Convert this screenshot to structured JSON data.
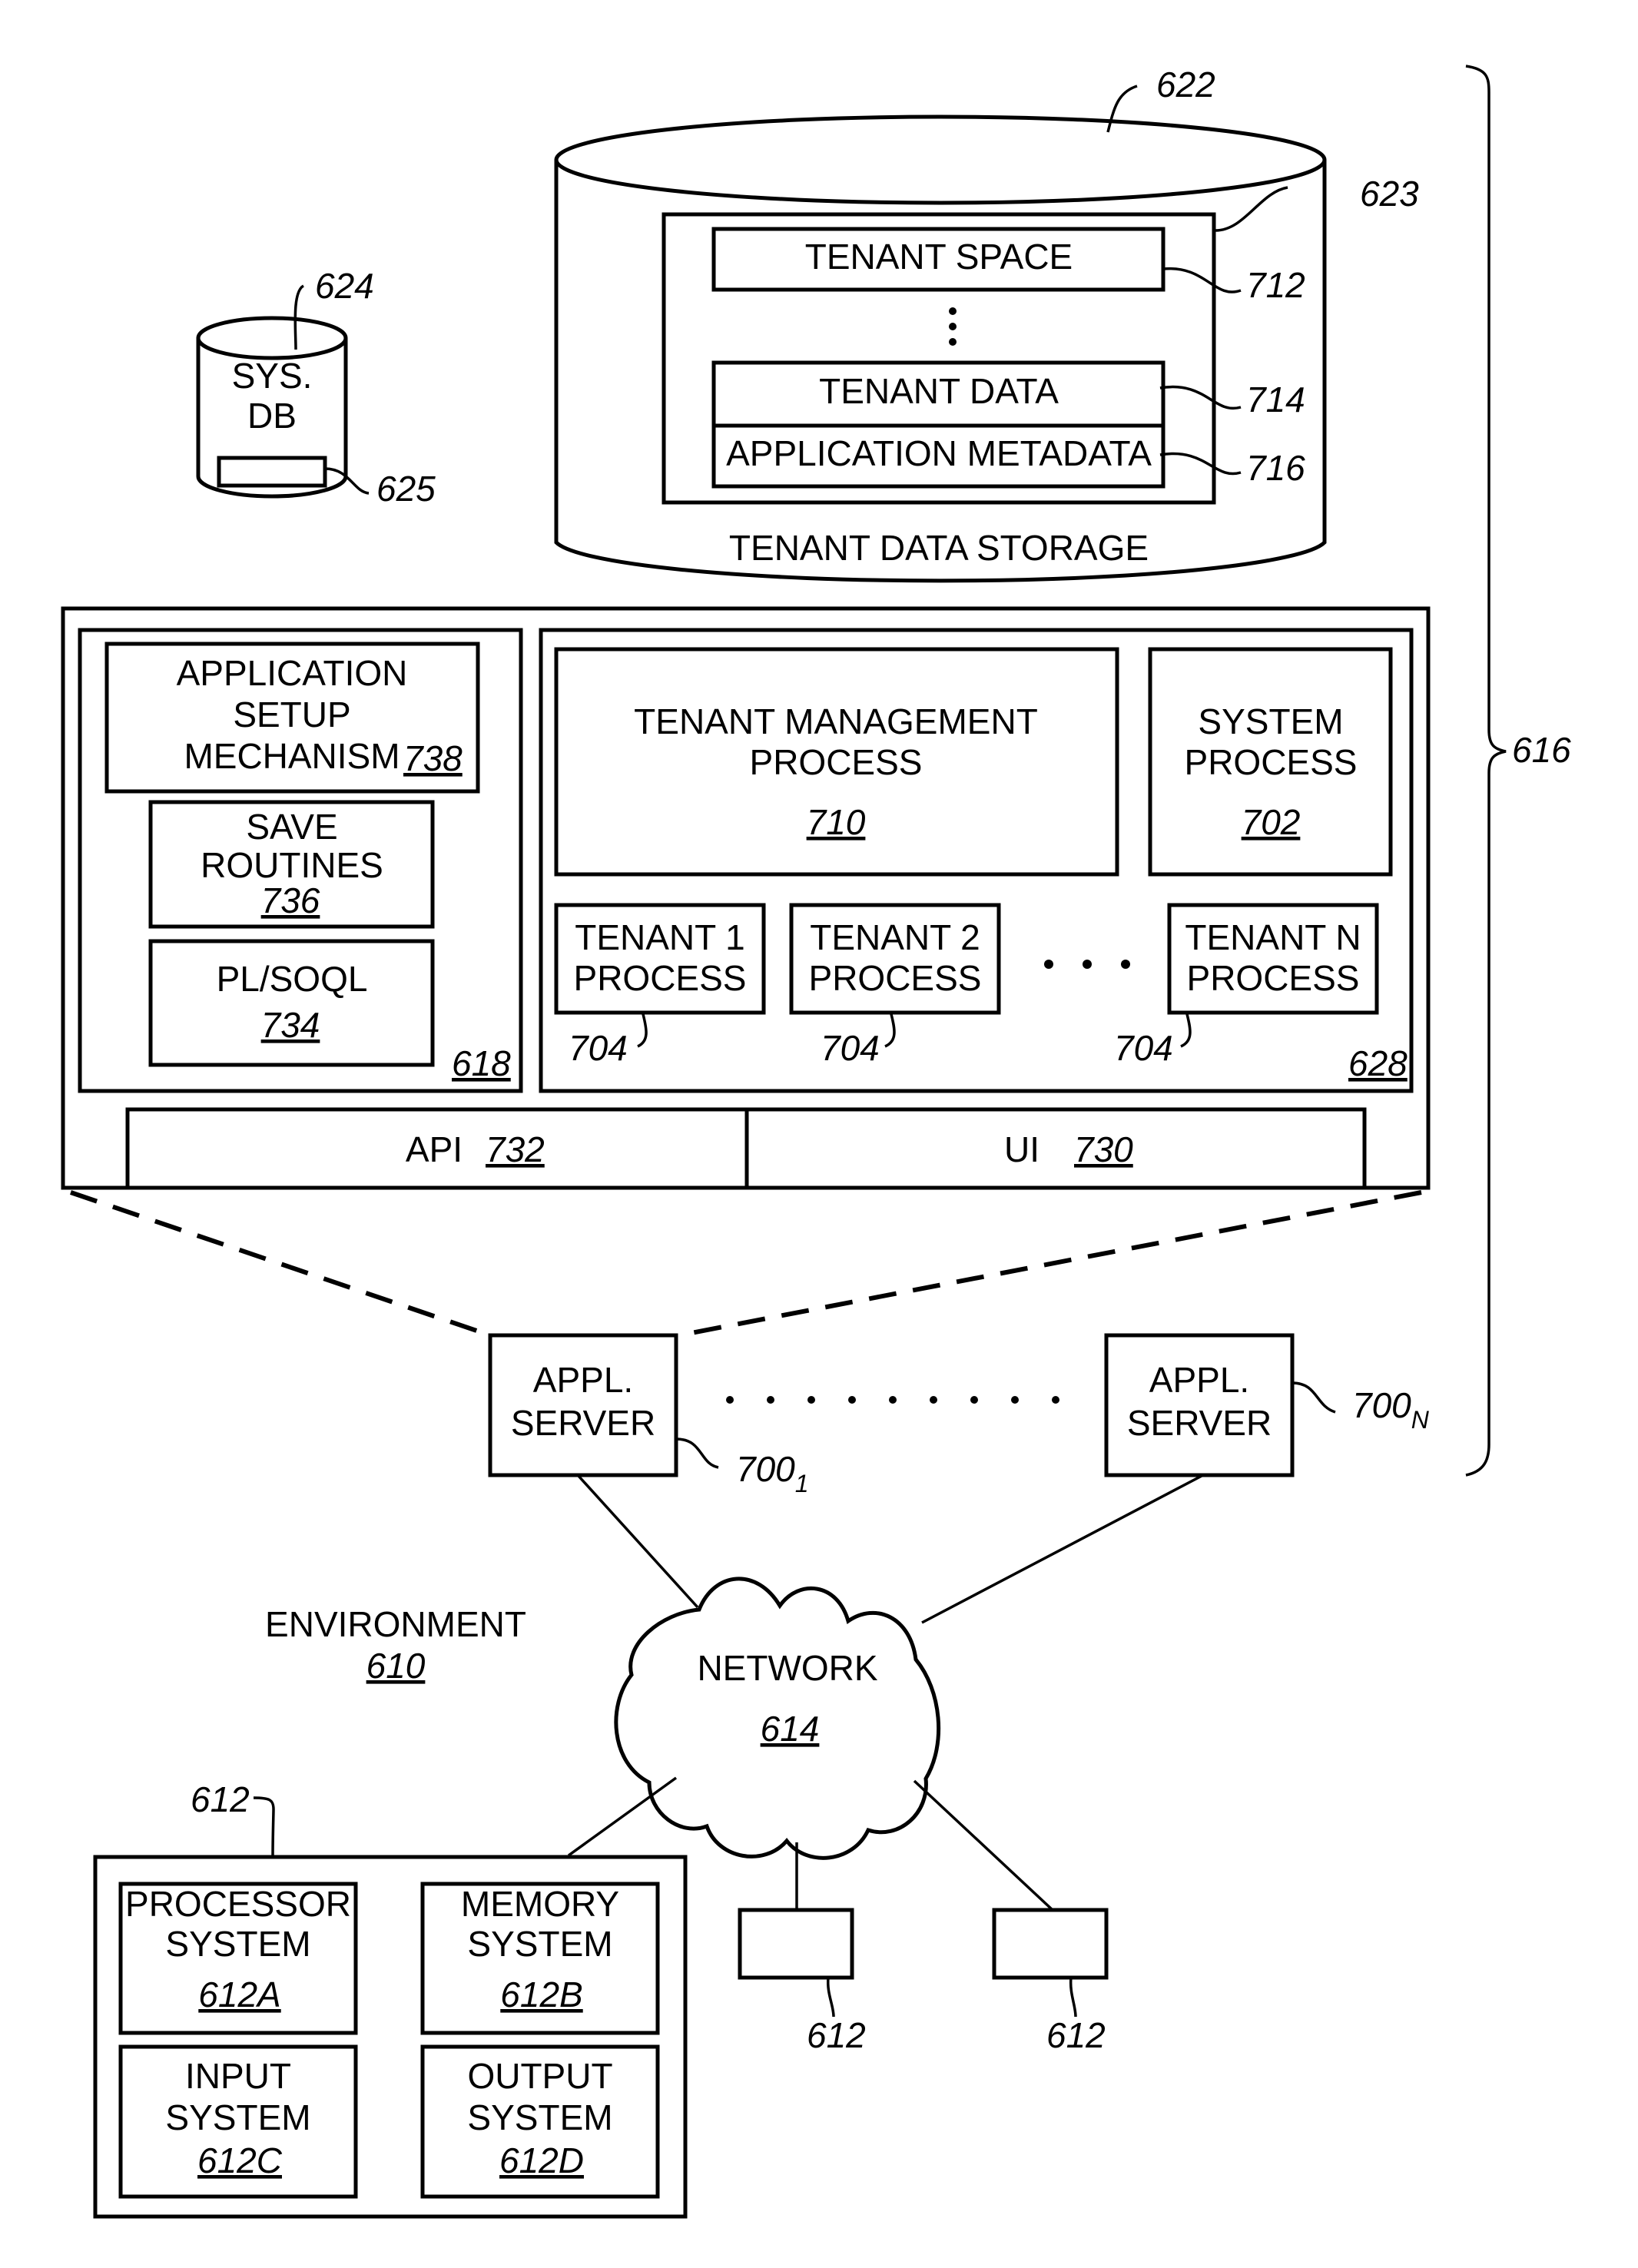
{
  "diagram": {
    "tenant_storage": {
      "ref": "622",
      "inner_ref": "623",
      "label": "TENANT DATA STORAGE",
      "tenant_space": {
        "label": "TENANT SPACE",
        "ref": "712"
      },
      "tenant_data": {
        "label": "TENANT DATA",
        "ref": "714"
      },
      "app_metadata": {
        "label": "APPLICATION METADATA",
        "ref": "716"
      }
    },
    "sys_db": {
      "line1": "SYS.",
      "line2": "DB",
      "ref": "624",
      "inner_ref": "625"
    },
    "system_ref": "616",
    "left_panel": {
      "ref": "618",
      "app_setup": {
        "line1": "APPLICATION",
        "line2": "SETUP",
        "line3": "MECHANISM",
        "ref": "738"
      },
      "save_routines": {
        "line1": "SAVE",
        "line2": "ROUTINES",
        "ref": "736"
      },
      "plsoql": {
        "line1": "PL/SOQL",
        "ref": "734"
      }
    },
    "right_panel": {
      "ref": "628",
      "tenant_mgmt": {
        "line1": "TENANT MANAGEMENT",
        "line2": "PROCESS",
        "ref": "710"
      },
      "system_process": {
        "line1": "SYSTEM",
        "line2": "PROCESS",
        "ref": "702"
      },
      "tenant_processes": [
        {
          "line1": "TENANT 1",
          "line2": "PROCESS",
          "ref": "704"
        },
        {
          "line1": "TENANT 2",
          "line2": "PROCESS",
          "ref": "704"
        },
        {
          "line1": "TENANT N",
          "line2": "PROCESS",
          "ref": "704"
        }
      ],
      "ellipsis": "•   •   •"
    },
    "api": {
      "label": "API",
      "ref": "732"
    },
    "ui": {
      "label": "UI",
      "ref": "730"
    },
    "servers": [
      {
        "line1": "APPL.",
        "line2": "SERVER",
        "ref": "700",
        "sub": "1"
      },
      {
        "line1": "APPL.",
        "line2": "SERVER",
        "ref": "700",
        "sub": "N"
      }
    ],
    "environment": {
      "label": "ENVIRONMENT",
      "ref": "610"
    },
    "network": {
      "label": "NETWORK",
      "ref": "614"
    },
    "user_system": {
      "ref": "612",
      "processor": {
        "line1": "PROCESSOR",
        "line2": "SYSTEM",
        "ref": "612A"
      },
      "memory": {
        "line1": "MEMORY",
        "line2": "SYSTEM",
        "ref": "612B"
      },
      "input": {
        "line1": "INPUT",
        "line2": "SYSTEM",
        "ref": "612C"
      },
      "output": {
        "line1": "OUTPUT",
        "line2": "SYSTEM",
        "ref": "612D"
      }
    },
    "other_users": [
      {
        "ref": "612"
      },
      {
        "ref": "612"
      }
    ]
  }
}
